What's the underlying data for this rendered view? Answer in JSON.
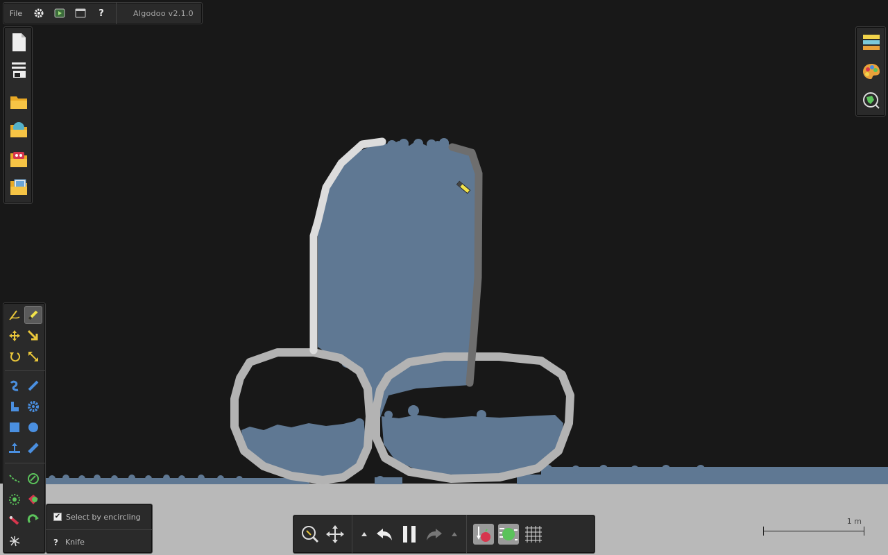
{
  "app": {
    "title": "Algodoo v2.1.0"
  },
  "menubar": {
    "file_label": "File",
    "items": [
      "gear-icon",
      "play-scene-icon",
      "window-icon",
      "help-icon"
    ],
    "help_label": "?"
  },
  "filebar": {
    "items": [
      "new-scene-icon",
      "scene-panel-icon",
      "open-folder-icon",
      "open-phunlet-icon",
      "open-algobox-icon",
      "browse-scenes-icon"
    ]
  },
  "rightbar": {
    "items": [
      "layers-icon",
      "palette-icon",
      "visualization-icon"
    ]
  },
  "tools": {
    "active": "knife",
    "groups": [
      [
        "sketch",
        "knife",
        "move",
        "drag",
        "rotate",
        "scale"
      ],
      [
        "rope",
        "spring",
        "polygon",
        "gear",
        "box",
        "circle",
        "plane",
        "brush"
      ],
      [
        "chain",
        "fixate",
        "thruster",
        "tracer",
        "laser",
        "hinge",
        "water"
      ]
    ]
  },
  "options": {
    "select_by_encircling_label": "Select by encircling",
    "select_by_encircling_checked": true,
    "help_label": "?",
    "tool_name": "Knife"
  },
  "playbar": {
    "buttons": [
      "zoom-icon",
      "pan-icon",
      "speed-up-icon",
      "undo-icon",
      "pause-icon",
      "redo-icon",
      "speed-down-icon",
      "gravity-icon",
      "air-friction-icon",
      "grid-icon"
    ]
  },
  "scale": {
    "label": "1 m"
  },
  "colors": {
    "background": "#181818",
    "ground": "#b9b9b9",
    "water": "#5f7893",
    "container_light": "#dcdcdc",
    "container_gray": "#b3b3b3",
    "container_dark": "#6e6e6e",
    "panel": "#2a2a2a"
  }
}
